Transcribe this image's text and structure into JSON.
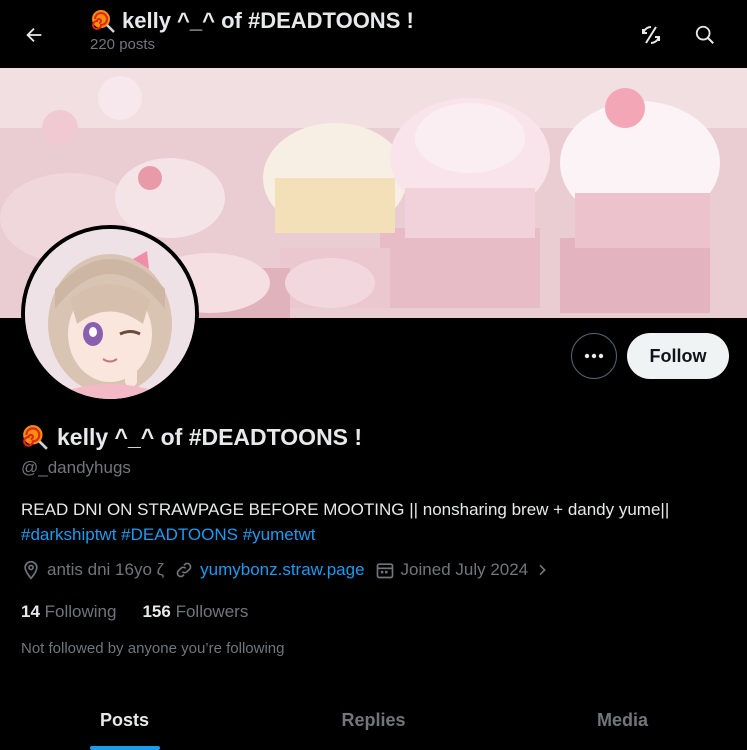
{
  "header": {
    "title": "kelly ^_^ of #DEADTOONS !",
    "post_count": "220 posts",
    "title_emoji_icon": "lollipop-icon"
  },
  "profile": {
    "display_name": "kelly ^_^ of #DEADTOONS !",
    "handle": "@_dandyhugs",
    "bio_text": "READ DNI ON STRAWPAGE BEFORE MOOTING || nonsharing brew + dandy yume||",
    "bio_hashtags": "#darkshiptwt #DEADTOONS #yumetwt",
    "location": "antis dni  16yo  ζ",
    "website": "yumybonz.straw.page",
    "joined": "Joined July 2024",
    "follow_label": "Follow",
    "following_count": "14",
    "following_label": "Following",
    "followers_count": "156",
    "followers_label": "Followers",
    "not_followed_text": "Not followed by anyone you’re following"
  },
  "tabs": [
    {
      "label": "Posts",
      "active": true
    },
    {
      "label": "Replies",
      "active": false
    },
    {
      "label": "Media",
      "active": false
    }
  ],
  "colors": {
    "accent": "#1d9bf0",
    "background": "#000000",
    "muted": "#71767b",
    "text": "#e7e9ea"
  }
}
